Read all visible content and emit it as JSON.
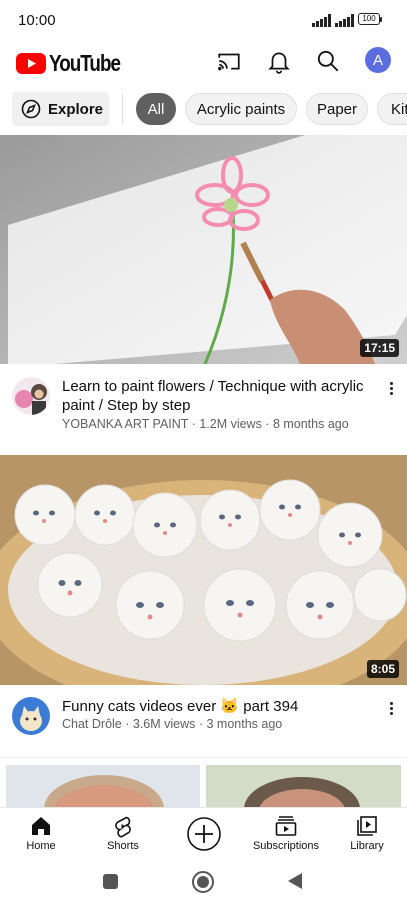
{
  "status": {
    "time": "10:00",
    "battery": "100"
  },
  "topbar": {
    "brand": "YouTube",
    "avatar_letter": "A"
  },
  "chips": {
    "explore_label": "Explore",
    "items": [
      "All",
      "Acrylic paints",
      "Paper",
      "Kit"
    ],
    "selected": "All"
  },
  "videos": [
    {
      "title": "Learn to paint flowers / Technique with acrylic paint / Step by step",
      "channel": "YOBANKA ART PAINT",
      "views": "1.2M views",
      "age": "8 months ago",
      "meta_line": "YOBANKA ART PAINT · 1.2M views · 8 months ago",
      "duration": "17:15"
    },
    {
      "title": "Funny cats videos ever 🐱 part 394",
      "channel": "Chat Drôle",
      "views": "3.6M views",
      "age": "3 months ago",
      "meta_line": "Chat Drôle · 3.6M views · 3 months ago",
      "duration": "8:05"
    }
  ],
  "bottom_nav": {
    "home": "Home",
    "shorts": "Shorts",
    "subscriptions": "Subscriptions",
    "library": "Library"
  },
  "colors": {
    "brand_red": "#ff0000",
    "avatar_blue": "#5b6ee0",
    "chip_active": "#606060"
  }
}
